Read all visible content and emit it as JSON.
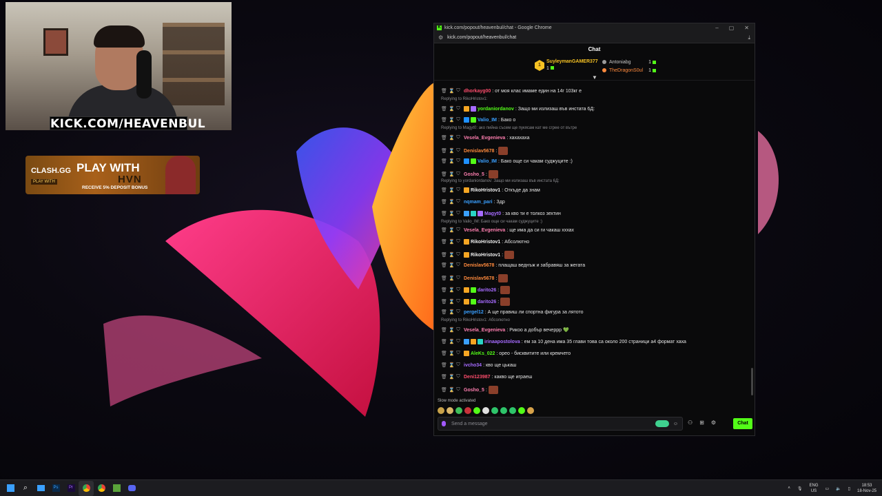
{
  "overlay": {
    "webcam_label": "KICK.COM/HEAVENBUL",
    "banner": {
      "brand": "CLASH.GG",
      "headline": "PLAY WITH",
      "partner": "HVN",
      "play_with_tag": "PLAY WITH",
      "bonus": "RECEIVE 5% DEPOSIT BONUS"
    }
  },
  "browser": {
    "title": "kick.com/popout/heavenbul/chat - Google Chrome",
    "url": "kick.com/popout/heavenbul/chat",
    "controls": [
      "–",
      "▢",
      "✕"
    ]
  },
  "chat": {
    "title": "Chat",
    "pinned": {
      "top_gifter": {
        "name": "SuyleymanGAMER377",
        "count": "1",
        "rank": "1"
      },
      "others": [
        {
          "name": "Antoniabg",
          "count": "1",
          "color": "#c8c8c8"
        },
        {
          "name": "TheDragonS0ul",
          "count": "1",
          "color": "#ff8a3d"
        }
      ]
    },
    "messages": [
      {
        "type": "msg",
        "user": "dhorkayg00",
        "color": "#ff4d6d",
        "text": ": от моя клас имаме един на 14г 103кг е",
        "badges": []
      },
      {
        "type": "reply",
        "text": "Replying to RikoHristov1:"
      },
      {
        "type": "msg",
        "user": "yordaniordanov",
        "color": "#53fc18",
        "text": ": Защо ми излизаш във инстата 6Д:",
        "badges": [
          "#f6a623",
          "#a66bff"
        ]
      },
      {
        "type": "msg",
        "user": "Valio_IM",
        "color": "#3aa0ff",
        "text": ": Бако о",
        "badges": [
          "#1e90ff",
          "#53fc18"
        ]
      },
      {
        "type": "reply",
        "text": "Replying to Magyt0: ако пийна съсем ще пукясам кат ме сгрее от вътре"
      },
      {
        "type": "msg",
        "user": "Vesela_Evgenieva",
        "color": "#ff7fb0",
        "text": ": хахахаха",
        "badges": []
      },
      {
        "type": "msg",
        "user": "Denislav5678",
        "color": "#ff8a3d",
        "text": ":",
        "badges": [],
        "emote": true
      },
      {
        "type": "msg",
        "user": "Valio_IM",
        "color": "#3aa0ff",
        "text": ": Бако още си чакам суджуците :)",
        "badges": [
          "#1e90ff",
          "#53fc18"
        ]
      },
      {
        "type": "msg",
        "user": "Gosho_5",
        "color": "#ff7fb0",
        "text": ":",
        "badges": [],
        "emote": true
      },
      {
        "type": "reply",
        "text": "Replying to yordaniordanov: Защо ми излизаш във инстата 6Д:"
      },
      {
        "type": "msg",
        "user": "RikoHristov1",
        "color": "#f0f0f0",
        "text": ": Откъде да знам",
        "badges": [
          "#f6a623"
        ]
      },
      {
        "type": "msg",
        "user": "nqmam_pari",
        "color": "#3aa0ff",
        "text": ": Здр",
        "badges": []
      },
      {
        "type": "msg",
        "user": "Magyt0",
        "color": "#a66bff",
        "text": ": за кво ти е толкоз зехтин",
        "badges": [
          "#3aa0ff",
          "#2ad4c5",
          "#a66bff"
        ]
      },
      {
        "type": "reply",
        "text": "Replying to Valio_IM: Бако още си чакам суджуците :)"
      },
      {
        "type": "msg",
        "user": "Vesela_Evgenieva",
        "color": "#ff7fb0",
        "text": ": ще има да си ги чакаш хххах",
        "badges": []
      },
      {
        "type": "msg",
        "user": "RikoHristov1",
        "color": "#f0f0f0",
        "text": ": Абсолютно",
        "badges": [
          "#f6a623"
        ]
      },
      {
        "type": "msg",
        "user": "RikoHristov1",
        "color": "#f0f0f0",
        "text": ":",
        "badges": [
          "#f6a623"
        ],
        "emote": true
      },
      {
        "type": "msg",
        "user": "Denislav5678",
        "color": "#ff8a3d",
        "text": ": плащаш веднъж и забравяш за жегата",
        "badges": []
      },
      {
        "type": "msg",
        "user": "Denislav5678",
        "color": "#ff8a3d",
        "text": ":",
        "badges": [],
        "emote": true
      },
      {
        "type": "msg",
        "user": "darito26",
        "color": "#a66bff",
        "text": ":",
        "badges": [
          "#f6a623",
          "#53fc18"
        ],
        "emote": true
      },
      {
        "type": "msg",
        "user": "darito26",
        "color": "#a66bff",
        "text": ":",
        "badges": [
          "#f6a623",
          "#53fc18"
        ],
        "emote": true
      },
      {
        "type": "msg",
        "user": "pergel12",
        "color": "#3aa0ff",
        "text": ": А ще правиш ли спортна фигура за лятото",
        "badges": []
      },
      {
        "type": "reply",
        "text": "Replying to RikoHristov1: Абсолютно"
      },
      {
        "type": "msg",
        "user": "Vesela_Evgenieva",
        "color": "#ff7fb0",
        "text": ": Рикоо а добър вечеррр 💚",
        "badges": []
      },
      {
        "type": "msg",
        "user": "irinaapostolova",
        "color": "#a66bff",
        "text": ": ем за 10 дена има 35 глави това са около 200 страници а4 формат хаха",
        "badges": [
          "#3aa0ff",
          "#f6a623",
          "#2ad4c5"
        ]
      },
      {
        "type": "msg",
        "user": "AleKs_022",
        "color": "#53fc18",
        "text": ": орео - бисквитите или кремчето",
        "badges": [
          "#f6a623"
        ]
      },
      {
        "type": "msg",
        "user": "ivcho34",
        "color": "#a66bff",
        "text": ": кво ще цькаш",
        "badges": []
      },
      {
        "type": "msg",
        "user": "Deni123987",
        "color": "#ff4d6d",
        "text": ": какво ще играеш",
        "badges": []
      },
      {
        "type": "msg",
        "user": "Gosho_5",
        "color": "#ff7fb0",
        "text": ":",
        "badges": [],
        "emote": true
      }
    ],
    "slow_mode": "Slow mode activated",
    "input_placeholder": "Send a message",
    "send_label": "Chat"
  },
  "taskbar": {
    "lang": "ENG",
    "region": "US",
    "time": "18:53",
    "date": "18-Nov-25"
  },
  "colors": {
    "kick_green": "#53fc18",
    "taskbar_bg": "#1c1c20",
    "chat_bg": "#0a0a0b"
  }
}
